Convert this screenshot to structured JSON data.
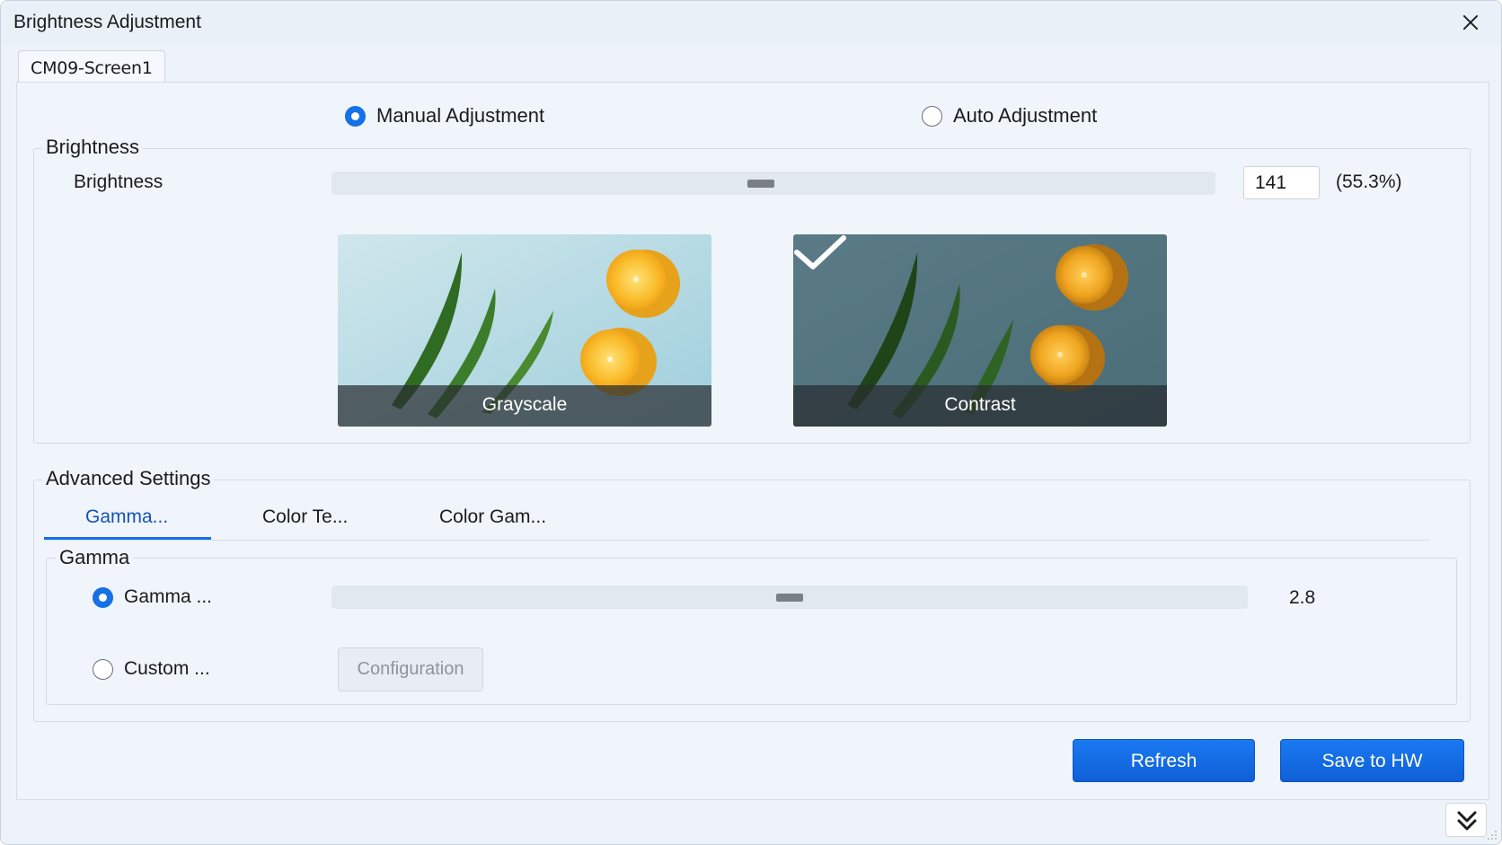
{
  "window": {
    "title": "Brightness Adjustment"
  },
  "screen_tab": {
    "label": "CM09-Screen1"
  },
  "mode": {
    "manual_label": "Manual Adjustment",
    "auto_label": "Auto Adjustment",
    "selected": "manual"
  },
  "brightness": {
    "group_title": "Brightness",
    "row_label": "Brightness",
    "value": "141",
    "percent": "(55.3%)",
    "slider_fraction": 0.485
  },
  "previews": [
    {
      "caption": "Grayscale",
      "selected": false
    },
    {
      "caption": "Contrast",
      "selected": true
    }
  ],
  "advanced": {
    "title": "Advanced Settings",
    "tabs": [
      "Gamma...",
      "Color Te...",
      "Color Gam..."
    ],
    "active_tab": 0
  },
  "gamma": {
    "group_title": "Gamma",
    "gamma_option_label": "Gamma ...",
    "custom_option_label": "Custom ...",
    "value": "2.8",
    "slider_fraction": 0.5,
    "configuration_label": "Configuration"
  },
  "actions": {
    "refresh_label": "Refresh",
    "save_label": "Save to HW"
  },
  "colors": {
    "accent": "#1670e6",
    "window_bg": "#eef3f9",
    "primary_button": "#1670e6"
  }
}
